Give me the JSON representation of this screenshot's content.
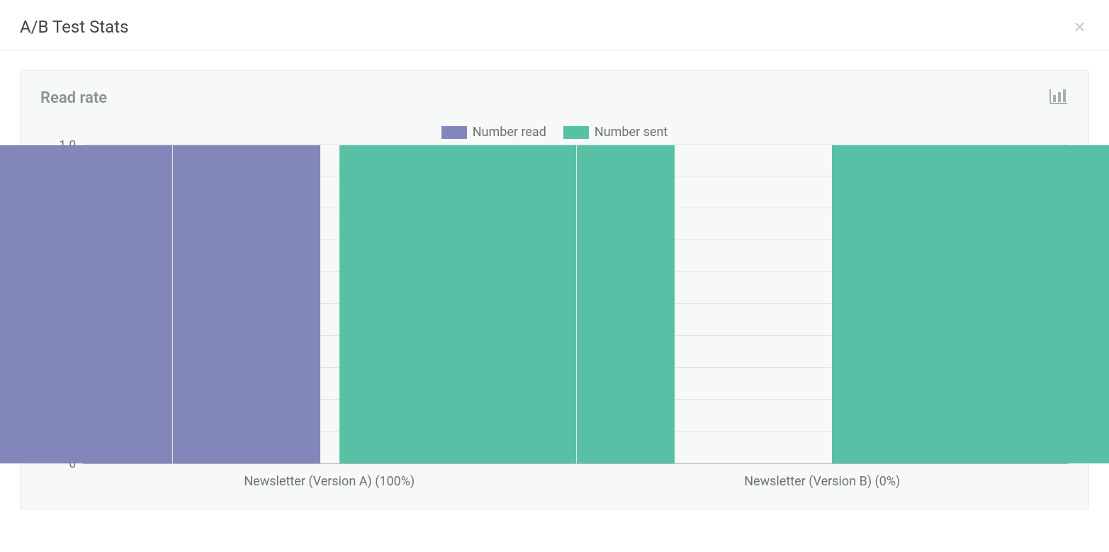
{
  "header": {
    "title": "A/B Test Stats",
    "close_symbol": "×"
  },
  "panel": {
    "title": "Read rate"
  },
  "legend": {
    "items": [
      {
        "label": "Number read",
        "color": "#8386b8"
      },
      {
        "label": "Number sent",
        "color": "#58c1a5"
      }
    ]
  },
  "chart_data": {
    "type": "bar",
    "title": "Read rate",
    "xlabel": "",
    "ylabel": "",
    "ylim": [
      0,
      1
    ],
    "y_ticks": [
      "0",
      "0.1",
      "0.2",
      "0.3",
      "0.4",
      "0.5",
      "0.6",
      "0.7",
      "0.8",
      "0.9",
      "1.0"
    ],
    "categories": [
      "Newsletter (Version A) (100%)",
      "Newsletter (Version B) (0%)"
    ],
    "series": [
      {
        "name": "Number read",
        "color": "#8386b8",
        "values": [
          1.0,
          0.0
        ]
      },
      {
        "name": "Number sent",
        "color": "#58c1a5",
        "values": [
          1.0,
          1.0
        ]
      }
    ]
  }
}
